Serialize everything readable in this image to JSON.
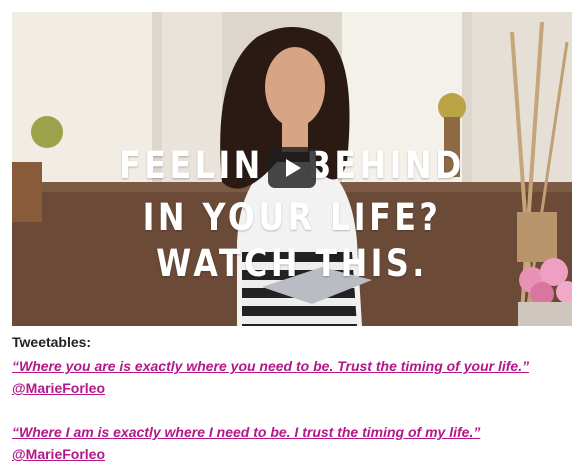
{
  "video": {
    "headline_line1_part1": "FEELIN",
    "headline_line1_part2": "BEHIND",
    "headline_line2": "IN YOUR LIFE?",
    "headline_line3": "WATCH THIS.",
    "play_icon": "play-icon"
  },
  "tweetables": {
    "heading": "Tweetables:",
    "items": [
      {
        "quote": "“Where you are is exactly where you need to be. Trust the timing of your life.”",
        "handle": "@MarieForleo"
      },
      {
        "quote": "“Where I am is exactly where I need to be. I trust the timing of my life.”",
        "handle": "@MarieForleo"
      }
    ]
  },
  "colors": {
    "link": "#b5178a",
    "heading": "#222222"
  }
}
